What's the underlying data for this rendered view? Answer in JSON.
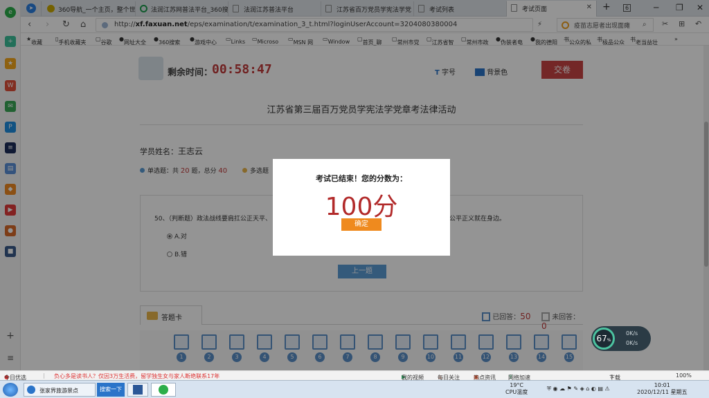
{
  "tabs": [
    {
      "label": "360导航_一个主页，整个世"
    },
    {
      "label": "法润江苏网普法平台_360搜"
    },
    {
      "label": "法润江苏普法平台"
    },
    {
      "label": "江苏省百万党员学宪法学党"
    },
    {
      "label": "考试列表"
    },
    {
      "label": "考试页面"
    }
  ],
  "window": {
    "tab_count": "6"
  },
  "address": {
    "url_prefix": "http://",
    "url_host": "xf.faxuan.net",
    "url_path": "/eps/examination/t/examination_3_t.html?loginUserAccount=3204080380004",
    "search_placeholder": "疫苗志愿者出现面瘫"
  },
  "bookmarks": [
    "收藏",
    "手机收藏夹",
    "谷歌",
    "网址大全",
    "360搜索",
    "游戏中心",
    "Links",
    "Microso",
    "MSN 网",
    "Window",
    "首页_聊",
    "常州市党",
    "江苏省智",
    "常州市政",
    "伪装者电",
    "我的德阳",
    "公众的私",
    "极品公众",
    "老当益壮"
  ],
  "exam": {
    "time_label": "剩余时间：",
    "time_value": "00:58:47",
    "font_label": "字号",
    "bg_label": "背景色",
    "submit_label": "交卷",
    "title": "江苏省第三届百万党员学宪法学党章考法律活动",
    "student_label": "学员姓名：",
    "student_name": "王志云",
    "single_label": "单选题：共",
    "single_count": "20",
    "single_mid": "题，总分",
    "single_score": "40",
    "multi_label": "多选题",
    "question_start": "50、（判断题）政法战线要肩扛公正天平、",
    "question_end": "受到公平正义就在身边。",
    "option_a": "A.对",
    "option_b": "B.错",
    "prev_label": "上一题",
    "card_label": "答题卡",
    "answered_label": "已回答：",
    "answered_count": "50",
    "unanswered_label": "未回答：",
    "unanswered_count": "0",
    "question_numbers": [
      "1",
      "2",
      "3",
      "4",
      "5",
      "6",
      "7",
      "8",
      "9",
      "10",
      "11",
      "12",
      "13",
      "14",
      "15"
    ]
  },
  "modal": {
    "message": "考试已结束！您的分数为：",
    "score": "100分",
    "ok_label": "确定"
  },
  "gauge": {
    "percent": "67",
    "unit": "%",
    "up": "0K/s",
    "down": "0K/s"
  },
  "statusbar": {
    "left": "今日优选",
    "news": "负心多是读书人？仅因3万生活费，留学独生女与家人断绝联系17年",
    "items": [
      "我的视频",
      "每日关注",
      "热点资讯",
      "网络加速",
      "下载"
    ],
    "zoom": "100%"
  },
  "taskbar": {
    "item1": "张家界旅游景点",
    "search": "搜索一下",
    "temp": "19°C",
    "cpu_label": "CPU温度",
    "time": "10:01",
    "date": "2020/12/11 星期五"
  }
}
